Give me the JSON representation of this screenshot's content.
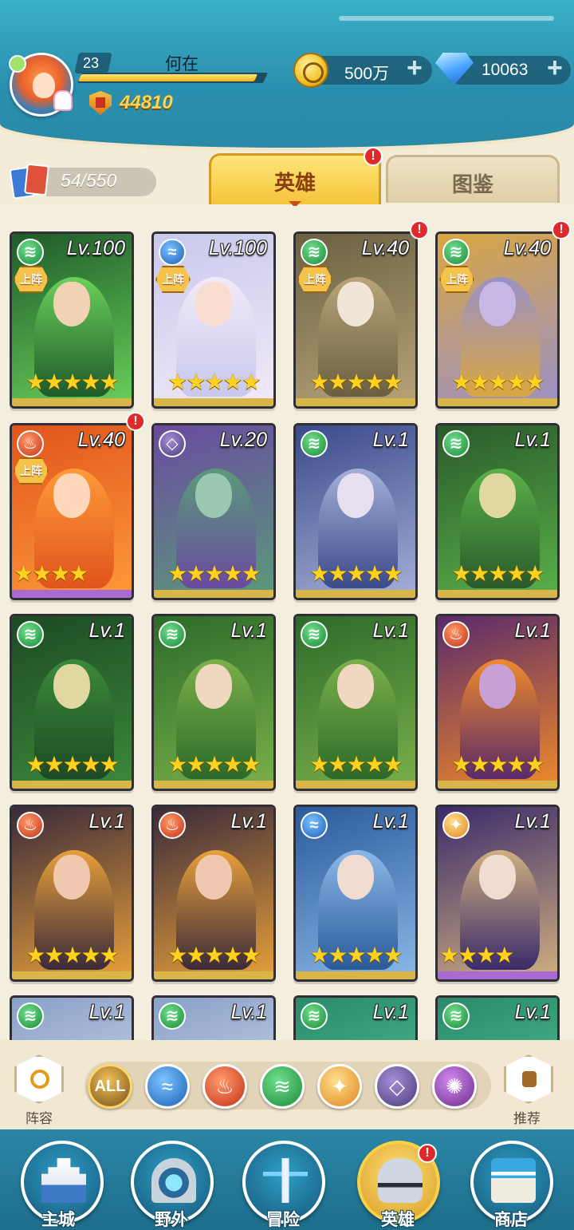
{
  "player": {
    "level": "23",
    "name": "何在",
    "exp_fraction": 0.95,
    "power": "44810"
  },
  "resources": {
    "gold": "500万",
    "gems": "10063",
    "gold_plus": "+",
    "gems_plus": "+"
  },
  "collection": {
    "count": "54/550"
  },
  "tabs": [
    {
      "label": "英雄",
      "active": true,
      "alert": "!"
    },
    {
      "label": "图鉴",
      "active": false
    }
  ],
  "heroes": [
    {
      "level": "Lv.100",
      "element": "wind",
      "deployed": "上阵",
      "stars": "★★★★★",
      "alert": ""
    },
    {
      "level": "Lv.100",
      "element": "water",
      "deployed": "上阵",
      "stars": "★★★★★",
      "alert": ""
    },
    {
      "level": "Lv.40",
      "element": "wind",
      "deployed": "上阵",
      "stars": "★★★★★",
      "alert": "!"
    },
    {
      "level": "Lv.40",
      "element": "wind",
      "deployed": "上阵",
      "stars": "★★★★★",
      "alert": "!"
    },
    {
      "level": "Lv.40",
      "element": "fire",
      "deployed": "上阵",
      "stars": "★★★★",
      "alert": "!"
    },
    {
      "level": "Lv.20",
      "element": "void",
      "deployed": "",
      "stars": "★★★★★",
      "alert": ""
    },
    {
      "level": "Lv.1",
      "element": "wind",
      "deployed": "",
      "stars": "★★★★★",
      "alert": ""
    },
    {
      "level": "Lv.1",
      "element": "wind",
      "deployed": "",
      "stars": "★★★★★",
      "alert": ""
    },
    {
      "level": "Lv.1",
      "element": "wind",
      "deployed": "",
      "stars": "★★★★★",
      "alert": ""
    },
    {
      "level": "Lv.1",
      "element": "wind",
      "deployed": "",
      "stars": "★★★★★",
      "alert": ""
    },
    {
      "level": "Lv.1",
      "element": "wind",
      "deployed": "",
      "stars": "★★★★★",
      "alert": ""
    },
    {
      "level": "Lv.1",
      "element": "fire",
      "deployed": "",
      "stars": "★★★★★",
      "alert": ""
    },
    {
      "level": "Lv.1",
      "element": "fire",
      "deployed": "",
      "stars": "★★★★★",
      "alert": ""
    },
    {
      "level": "Lv.1",
      "element": "fire",
      "deployed": "",
      "stars": "★★★★★",
      "alert": ""
    },
    {
      "level": "Lv.1",
      "element": "water",
      "deployed": "",
      "stars": "★★★★★",
      "alert": ""
    },
    {
      "level": "Lv.1",
      "element": "light",
      "deployed": "",
      "stars": "★★★★",
      "alert": ""
    },
    {
      "level": "Lv.1",
      "element": "wind",
      "deployed": "",
      "stars": "",
      "alert": ""
    },
    {
      "level": "Lv.1",
      "element": "wind",
      "deployed": "",
      "stars": "",
      "alert": ""
    },
    {
      "level": "Lv.1",
      "element": "wind",
      "deployed": "",
      "stars": "",
      "alert": ""
    },
    {
      "level": "Lv.1",
      "element": "wind",
      "deployed": "",
      "stars": "",
      "alert": ""
    }
  ],
  "filters": {
    "lineup_label": "阵容",
    "recommend_label": "推荐",
    "all_label": "ALL",
    "elements": [
      "water-element-icon",
      "fire-element-icon",
      "wind-element-icon",
      "light-element-icon",
      "void-element-icon",
      "arcane-element-icon"
    ]
  },
  "nav": [
    {
      "label": "主城",
      "active": false
    },
    {
      "label": "野外",
      "active": false
    },
    {
      "label": "冒险",
      "active": false
    },
    {
      "label": "英雄",
      "active": true,
      "alert": "!"
    },
    {
      "label": "商店",
      "active": false
    }
  ],
  "colors": {
    "accent_gold": "#f5c53b",
    "header_teal": "#2a8fae",
    "alert_red": "#e02a2a"
  }
}
